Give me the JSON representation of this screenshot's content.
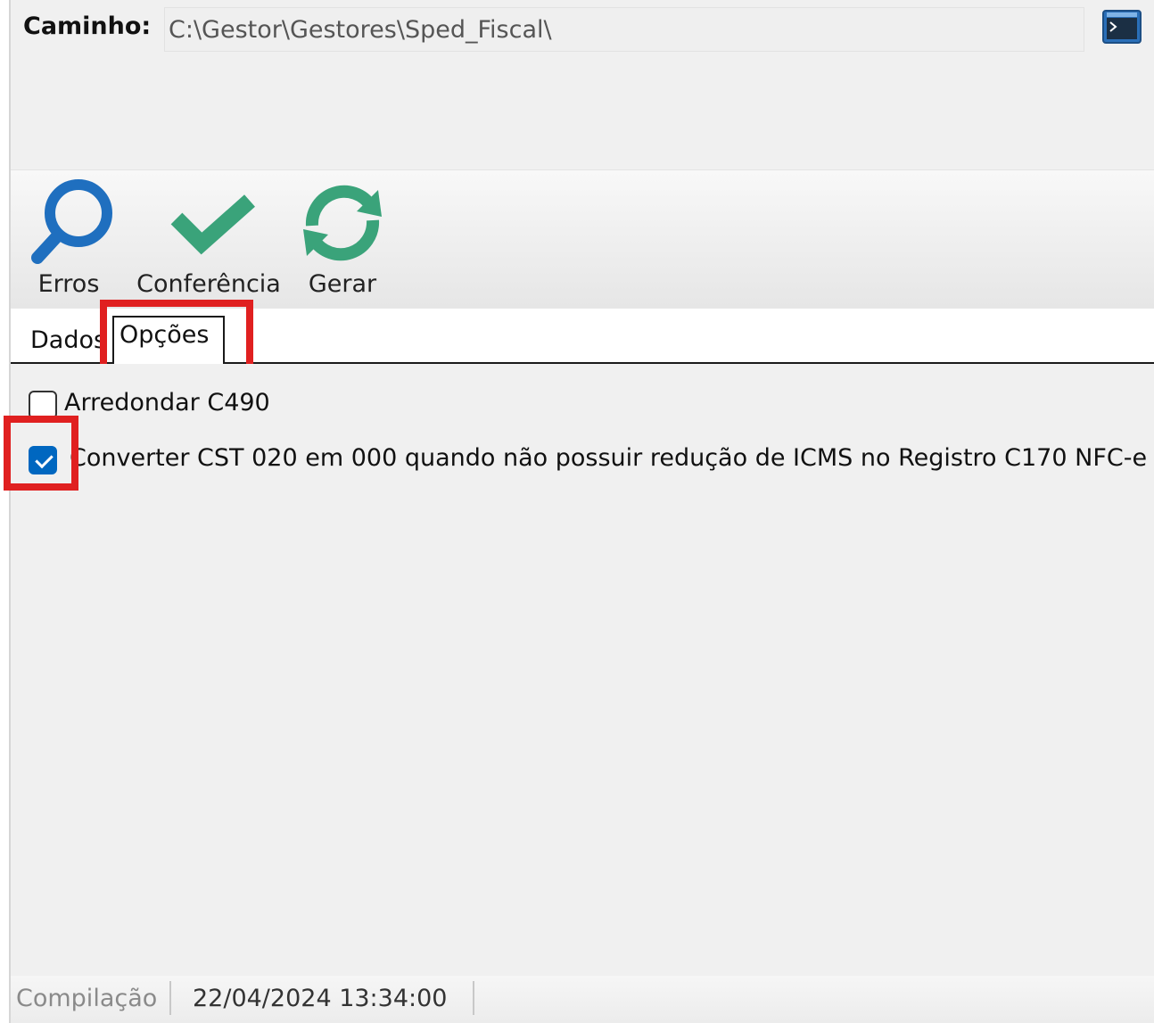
{
  "path": {
    "label": "Caminho:",
    "value": "C:\\Gestor\\Gestores\\Sped_Fiscal\\",
    "browse_icon": "console-window-icon"
  },
  "toolbar": {
    "items": [
      {
        "label": "Erros",
        "icon": "search-icon",
        "color": "#1f6fbf"
      },
      {
        "label": "Conferência",
        "icon": "checkmark-icon",
        "color": "#3aa37a"
      },
      {
        "label": "Gerar",
        "icon": "refresh-icon",
        "color": "#3aa37a"
      }
    ]
  },
  "tabs": [
    {
      "label": "Dados",
      "active": false
    },
    {
      "label": "Opções",
      "active": true
    }
  ],
  "options": [
    {
      "label": "Arredondar C490",
      "checked": false
    },
    {
      "label": "Converter CST 020 em 000 quando não possuir redução de ICMS no Registro C170 NFC-e",
      "checked": true
    }
  ],
  "status": {
    "label": "Compilação",
    "datetime": "22/04/2024 13:34:00"
  },
  "colors": {
    "highlight": "#e02020",
    "checkbox_checked": "#0067c0"
  }
}
